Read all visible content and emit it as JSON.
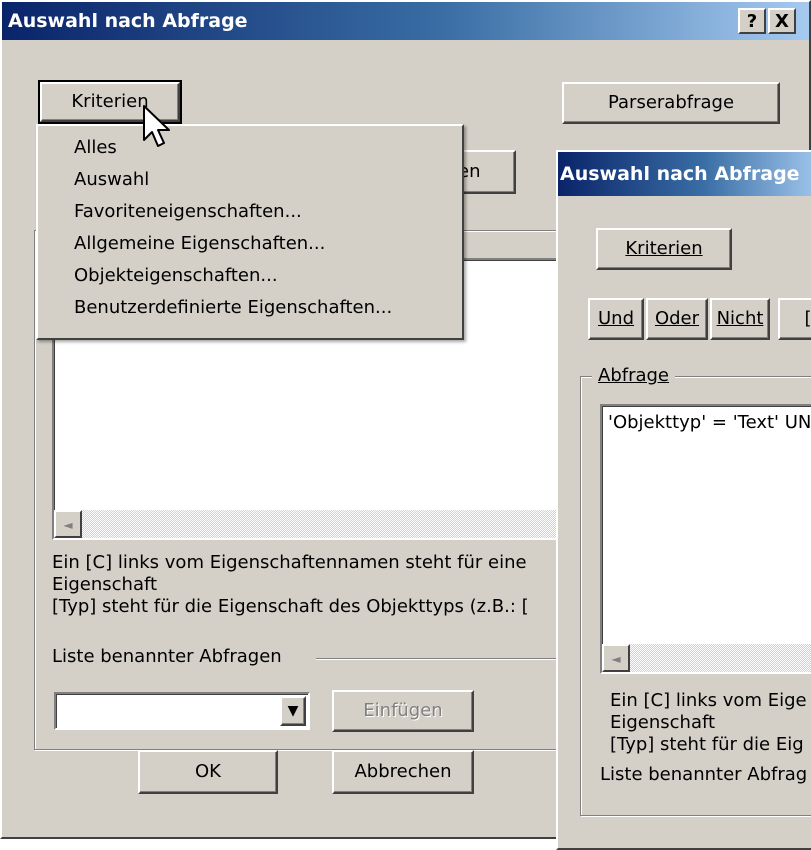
{
  "back_dialog": {
    "title": "Auswahl nach Abfrage",
    "help_button": "?",
    "close_button": "X",
    "criteria_button": "Kriterien",
    "parser_button": "Parserabfrage",
    "partial_button_text": "en",
    "scroll_left_arrow": "◄",
    "info_text": [
      "Ein [C] links vom Eigenschaftennamen steht für eine",
      "Eigenschaft",
      "[Typ] steht für die Eigenschaft des Objekttyps (z.B.: ["
    ],
    "named_queries_label": "Liste benannter Abfragen",
    "named_queries_value": "",
    "dropdown_arrow": "▼",
    "insert_button": "Einfügen",
    "ok_button": "OK",
    "cancel_button": "Abbrechen"
  },
  "criteria_menu": {
    "items": [
      "Alles",
      "Auswahl",
      "Favoriteneigenschaften...",
      "Allgemeine Eigenschaften...",
      "Objekteigenschaften...",
      "Benutzerdefinierte Eigenschaften..."
    ]
  },
  "front_dialog": {
    "title": "Auswahl nach Abfrage",
    "criteria_button": "Kriterien",
    "and_button": "Und",
    "or_button": "Oder",
    "not_button": "Nicht",
    "partial_button": "[",
    "query_group_label": "Abfrage",
    "query_text": "'Objekttyp' = 'Text' UN",
    "scroll_left_arrow": "◄",
    "info_text": [
      "Ein [C] links vom Eige",
      "Eigenschaft",
      "[Typ] steht für die Eig"
    ],
    "named_queries_label": "Liste benannter Abfrag"
  },
  "colors": {
    "dialog_face": "#d4d0c8",
    "title_start": "#0a246a",
    "title_end": "#a6caf0",
    "disabled_text": "#808080"
  }
}
